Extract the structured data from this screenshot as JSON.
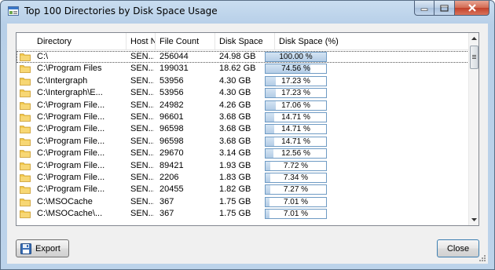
{
  "window": {
    "title": "Top 100 Directories by Disk Space Usage"
  },
  "icons": {
    "app": "app-icon",
    "folder": "folder-icon",
    "minimize": "minimize-icon",
    "maximize": "maximize-icon",
    "close": "close-icon",
    "export": "floppy-disk-icon"
  },
  "colors": {
    "progress_fill": "#b3cde6",
    "progress_border": "#6f9bc4",
    "folder": "#f2c94c",
    "close_button": "#c2402a"
  },
  "columns": [
    "Directory",
    "Host N",
    "File Count",
    "Disk Space",
    "Disk Space (%)"
  ],
  "rows": [
    {
      "directory": "C:\\",
      "host": "SEN...",
      "file_count": "256044",
      "disk_space": "24.98 GB",
      "percent_label": "100.00 %",
      "percent": 100.0
    },
    {
      "directory": "C:\\Program Files",
      "host": "SEN...",
      "file_count": "199031",
      "disk_space": "18.62 GB",
      "percent_label": "74.56 %",
      "percent": 74.56
    },
    {
      "directory": "C:\\Intergraph",
      "host": "SEN...",
      "file_count": "53956",
      "disk_space": "4.30 GB",
      "percent_label": "17.23 %",
      "percent": 17.23
    },
    {
      "directory": "C:\\Intergraph\\E...",
      "host": "SEN...",
      "file_count": "53956",
      "disk_space": "4.30 GB",
      "percent_label": "17.23 %",
      "percent": 17.23
    },
    {
      "directory": "C:\\Program File...",
      "host": "SEN...",
      "file_count": "24982",
      "disk_space": "4.26 GB",
      "percent_label": "17.06 %",
      "percent": 17.06
    },
    {
      "directory": "C:\\Program File...",
      "host": "SEN...",
      "file_count": "96601",
      "disk_space": "3.68 GB",
      "percent_label": "14.71 %",
      "percent": 14.71
    },
    {
      "directory": "C:\\Program File...",
      "host": "SEN...",
      "file_count": "96598",
      "disk_space": "3.68 GB",
      "percent_label": "14.71 %",
      "percent": 14.71
    },
    {
      "directory": "C:\\Program File...",
      "host": "SEN...",
      "file_count": "96598",
      "disk_space": "3.68 GB",
      "percent_label": "14.71 %",
      "percent": 14.71
    },
    {
      "directory": "C:\\Program File...",
      "host": "SEN...",
      "file_count": "29670",
      "disk_space": "3.14 GB",
      "percent_label": "12.56 %",
      "percent": 12.56
    },
    {
      "directory": "C:\\Program File...",
      "host": "SEN...",
      "file_count": "89421",
      "disk_space": "1.93 GB",
      "percent_label": "7.72 %",
      "percent": 7.72
    },
    {
      "directory": "C:\\Program File...",
      "host": "SEN...",
      "file_count": "2206",
      "disk_space": "1.83 GB",
      "percent_label": "7.34 %",
      "percent": 7.34
    },
    {
      "directory": "C:\\Program File...",
      "host": "SEN...",
      "file_count": "20455",
      "disk_space": "1.82 GB",
      "percent_label": "7.27 %",
      "percent": 7.27
    },
    {
      "directory": "C:\\MSOCache",
      "host": "SEN...",
      "file_count": "367",
      "disk_space": "1.75 GB",
      "percent_label": "7.01 %",
      "percent": 7.01
    },
    {
      "directory": "C:\\MSOCache\\...",
      "host": "SEN...",
      "file_count": "367",
      "disk_space": "1.75 GB",
      "percent_label": "7.01 %",
      "percent": 7.01
    }
  ],
  "buttons": {
    "export": "Export",
    "close": "Close"
  }
}
